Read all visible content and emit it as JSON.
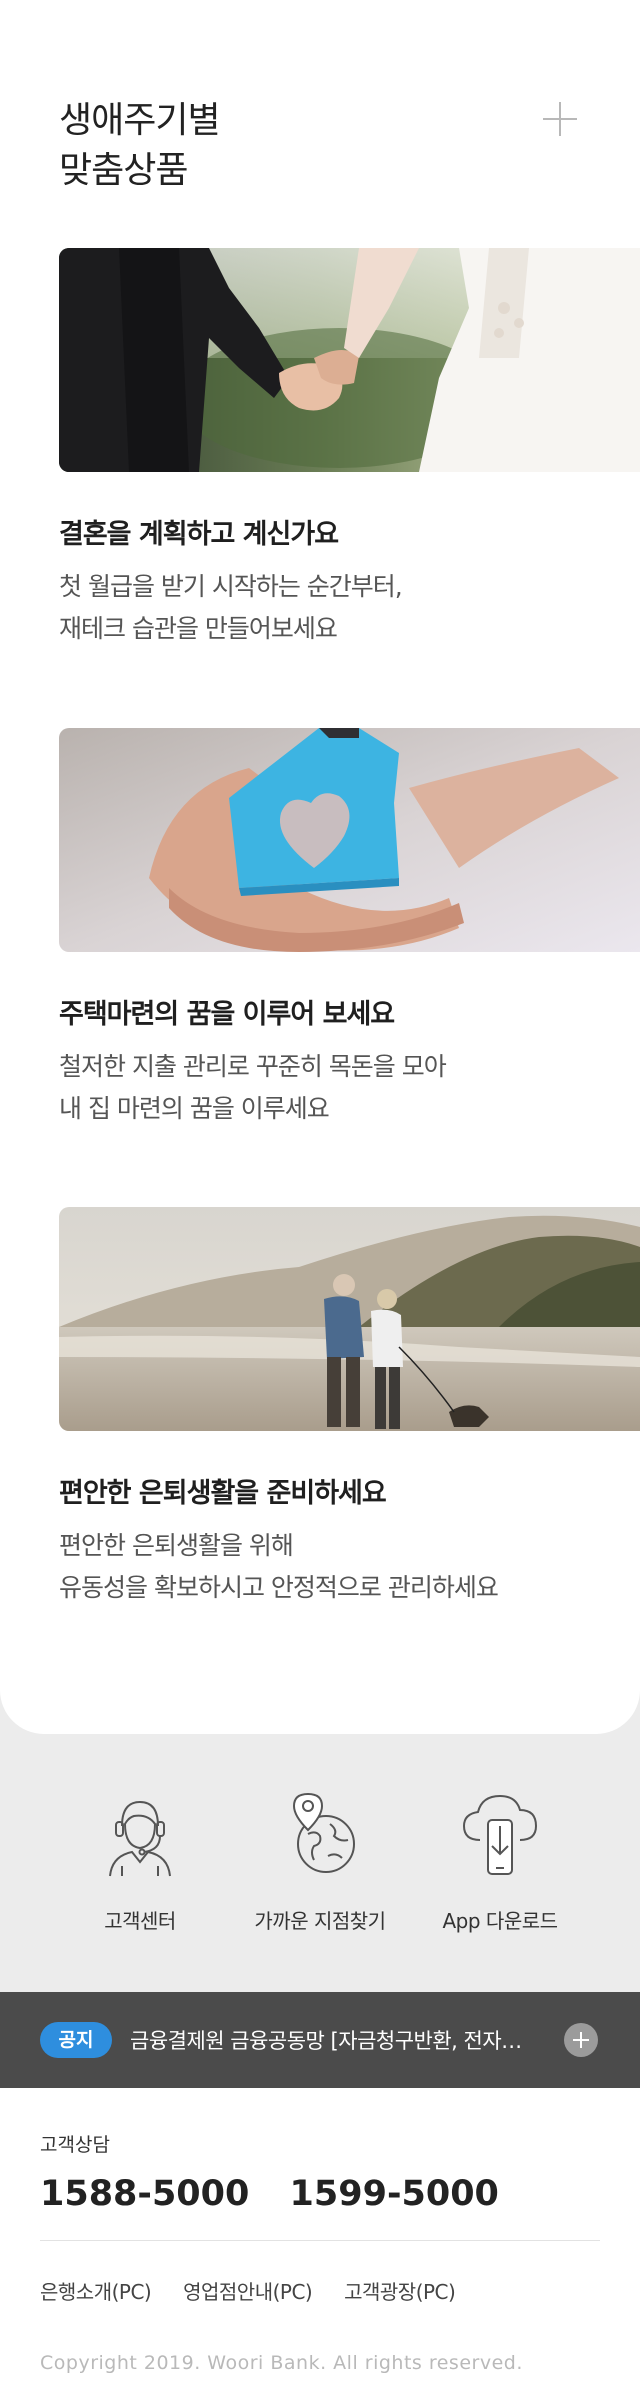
{
  "products_section": {
    "title": "생애주기별\n맞춤상품",
    "more_icon": "plus-icon",
    "items": [
      {
        "title": "결혼을 계획하고 계신가요",
        "desc_line1": "첫 월급을 받기 시작하는 순간부터,",
        "desc_line2": "재테크 습관을 만들어보세요",
        "image": "wedding-couple-holding-hands-photo"
      },
      {
        "title": "주택마련의 꿈을 이루어 보세요",
        "desc_line1": "철저한 지출 관리로 꾸준히 목돈을 모아",
        "desc_line2": "내 집 마련의 꿈을 이루세요",
        "image": "hands-holding-house-heart-photo"
      },
      {
        "title": "편안한 은퇴생활을 준비하세요",
        "desc_line1": "편안한 은퇴생활을 위해",
        "desc_line2": "유동성을 확보하시고 안정적으로 관리하세요",
        "image": "senior-couple-beach-walk-photo"
      }
    ]
  },
  "quick_menu": [
    {
      "label": "고객센터",
      "icon": "headset-agent-icon"
    },
    {
      "label": "가까운 지점찾기",
      "icon": "location-globe-icon"
    },
    {
      "label": "App 다운로드",
      "icon": "cloud-download-phone-icon"
    }
  ],
  "notice": {
    "badge": "공지",
    "text": "금융결제원 금융공동망 [자금청구반환, 전자금융...",
    "more_icon": "plus-circle-icon"
  },
  "footer": {
    "cs_label": "고객상담",
    "phone1": "1588-5000",
    "phone2": "1599-5000",
    "links": [
      "은행소개(PC)",
      "영업점안내(PC)",
      "고객광장(PC)"
    ],
    "copyright": "Copyright 2019. Woori Bank. All rights reserved."
  },
  "colors": {
    "badge": "#2e8ede",
    "notice_bg": "#4b4b4b",
    "page_bg": "#ececec"
  }
}
